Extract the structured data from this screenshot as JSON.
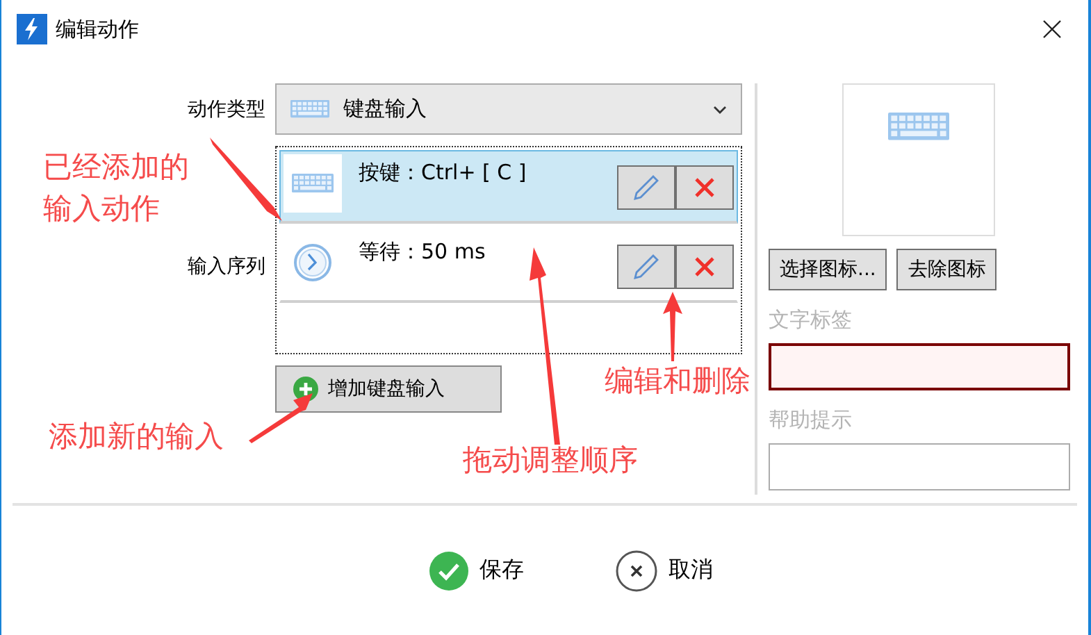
{
  "window": {
    "title": "编辑动作"
  },
  "form": {
    "action_type_label": "动作类型",
    "action_type": {
      "value": "键盘输入"
    },
    "sequence_label": "输入序列",
    "sequence": [
      {
        "kind": "key",
        "text": "按键：Ctrl+ [ C ]",
        "selected": true
      },
      {
        "kind": "wait",
        "text": "等待：50 ms",
        "selected": false
      }
    ],
    "add_button": "增加键盘输入"
  },
  "icon_panel": {
    "choose_button": "选择图标...",
    "remove_button": "去除图标",
    "text_label": {
      "label": "文字标签",
      "invalid": true
    },
    "help_hint": {
      "label": "帮助提示",
      "invalid": false
    }
  },
  "footer": {
    "buttons": [
      {
        "kind": "save",
        "label": "保存"
      },
      {
        "kind": "cancel",
        "label": "取消"
      }
    ]
  },
  "annotations": [
    {
      "text": "已经添加的"
    },
    {
      "text": "输入动作"
    },
    {
      "text": "添加新的输入"
    },
    {
      "text": "拖动调整顺序"
    },
    {
      "text": "编辑和删除"
    }
  ]
}
